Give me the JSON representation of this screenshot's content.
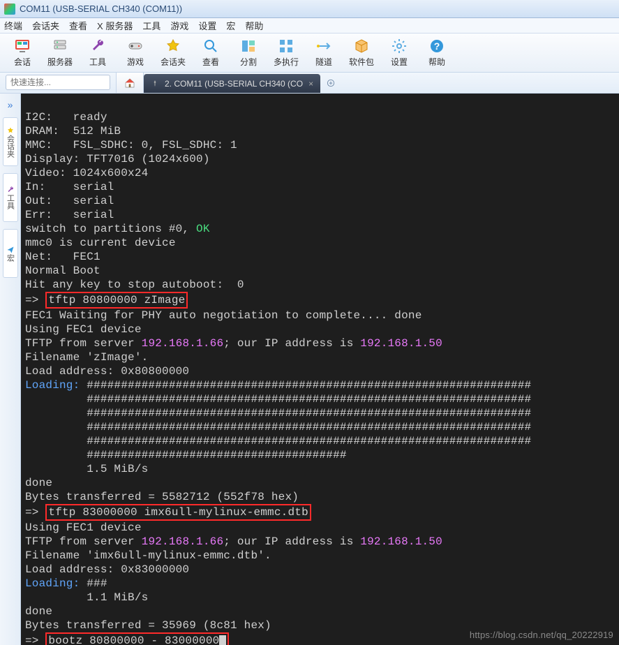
{
  "window": {
    "title": "COM11  (USB-SERIAL CH340 (COM11))"
  },
  "menus": [
    "终端",
    "会话夹",
    "查看",
    "X 服务器",
    "工具",
    "游戏",
    "设置",
    "宏",
    "帮助"
  ],
  "toolbar": [
    {
      "name": "sessions",
      "label": "会话",
      "color": "#e74c3c"
    },
    {
      "name": "servers",
      "label": "服务器",
      "color": "#2ecc71"
    },
    {
      "name": "tools",
      "label": "工具",
      "color": "#8e44ad"
    },
    {
      "name": "games",
      "label": "游戏",
      "color": "#e67e22"
    },
    {
      "name": "sessions-folder",
      "label": "会话夹",
      "color": "#f1c40f"
    },
    {
      "name": "view",
      "label": "查看",
      "color": "#3498db"
    },
    {
      "name": "split",
      "label": "分割",
      "color": "#16a085"
    },
    {
      "name": "multiexec",
      "label": "多执行",
      "color": "#5dade2"
    },
    {
      "name": "tunneling",
      "label": "隧道",
      "color": "#5dade2"
    },
    {
      "name": "packages",
      "label": "软件包",
      "color": "#f39c12"
    },
    {
      "name": "settings",
      "label": "设置",
      "color": "#5dade2"
    },
    {
      "name": "help",
      "label": "帮助",
      "color": "#3498db"
    }
  ],
  "quick_connect_placeholder": "快速连接...",
  "tab": {
    "label": "2. COM11  (USB-SERIAL CH340 (CO",
    "close": "×"
  },
  "sidebar": {
    "sessions": "会话夹",
    "tools": "工具",
    "macros": "宏"
  },
  "terminal": {
    "l01": "I2C:   ready",
    "l02": "DRAM:  512 MiB",
    "l03": "MMC:   FSL_SDHC: 0, FSL_SDHC: 1",
    "l04": "Display: TFT7016 (1024x600)",
    "l05": "Video: 1024x600x24",
    "l06": "In:    serial",
    "l07": "Out:   serial",
    "l08": "Err:   serial",
    "l09a": "switch to partitions #0, ",
    "l09b": "OK",
    "l10": "mmc0 is current device",
    "l11": "Net:   FEC1",
    "l12": "Normal Boot",
    "l13": "Hit any key to stop autoboot:  0",
    "l14a": "=> ",
    "l14b": "tftp 80800000 zImage",
    "l15": "FEC1 Waiting for PHY auto negotiation to complete.... done",
    "l16": "Using FEC1 device",
    "l17a": "TFTP from server ",
    "l17b": "192.168.1.66",
    "l17c": "; our IP address is ",
    "l17d": "192.168.1.50",
    "l18": "Filename 'zImage'.",
    "l19": "Load address: 0x80800000",
    "l20a": "Loading: ",
    "hr": "#################################################################",
    "l26": "         ######################################",
    "l27": "         1.5 MiB/s",
    "l28": "done",
    "l29": "Bytes transferred = 5582712 (552f78 hex)",
    "l30a": "=> ",
    "l30b": "tftp 83000000 imx6ull-mylinux-emmc.dtb",
    "l31": "Using FEC1 device",
    "l32a": "TFTP from server ",
    "l32b": "192.168.1.66",
    "l32c": "; our IP address is ",
    "l32d": "192.168.1.50",
    "l33": "Filename 'imx6ull-mylinux-emmc.dtb'.",
    "l34": "Load address: 0x83000000",
    "l35a": "Loading: ",
    "l35b": "###",
    "l36": "         1.1 MiB/s",
    "l37": "done",
    "l38": "Bytes transferred = 35969 (8c81 hex)",
    "l39a": "=> ",
    "l39b": "bootz 80800000 - 83000000"
  },
  "watermark": "https://blog.csdn.net/qq_20222919"
}
